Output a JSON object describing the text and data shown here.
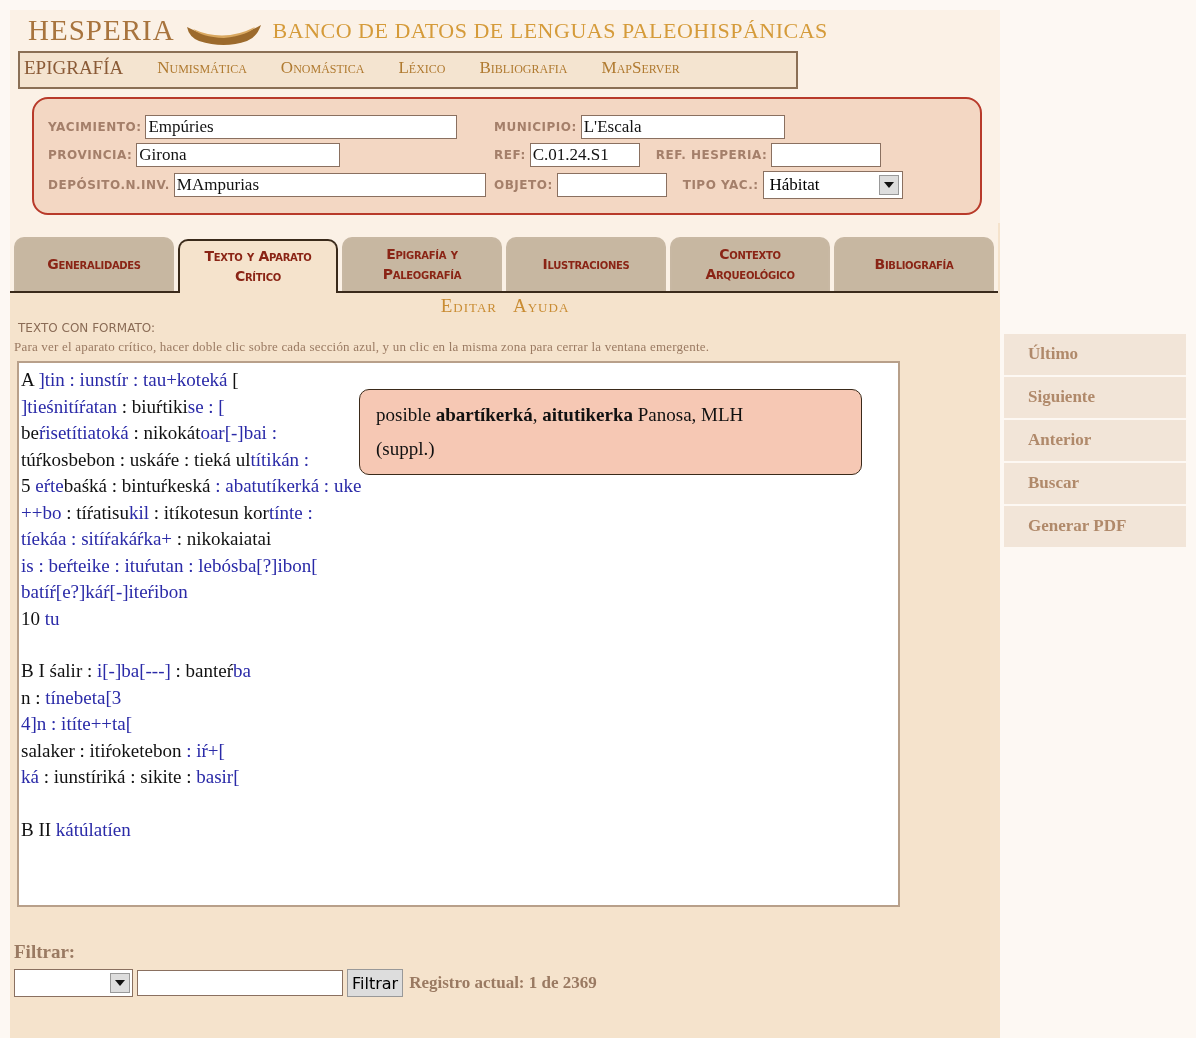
{
  "header": {
    "title": "HESPERIA",
    "subtitle": "BANCO DE DATOS DE LENGUAS PALEOHISPÁNICAS"
  },
  "nav": [
    {
      "label": "EPIGRAFÍA",
      "selected": true
    },
    {
      "label": "Numismática",
      "selected": false
    },
    {
      "label": "Onomástica",
      "selected": false
    },
    {
      "label": "Léxico",
      "selected": false
    },
    {
      "label": "Bibliografia",
      "selected": false
    },
    {
      "label": "MapServer",
      "selected": false
    }
  ],
  "form": {
    "rows": [
      [
        {
          "label": "YACIMIENTO:",
          "value": "Empúries",
          "kind": "text"
        },
        {
          "label": "MUNICIPIO:",
          "value": "L'Escala",
          "kind": "text"
        }
      ],
      [
        {
          "label": "PROVINCIA:",
          "value": "Girona",
          "kind": "text"
        },
        {
          "label": "REF:",
          "value": "C.01.24.S1",
          "kind": "text"
        },
        {
          "label": "REF. HESPERIA:",
          "kind": "text"
        }
      ],
      [
        {
          "label": "DEPÓSITO.N.INV.",
          "value": "MAmpurias",
          "kind": "text"
        },
        {
          "label": "OBJETO:",
          "kind": "text"
        },
        {
          "label": "TIPO YAC.:",
          "value": "Hábitat",
          "kind": "select"
        }
      ]
    ]
  },
  "tabs": [
    {
      "label": "Generalidades",
      "selected": false
    },
    {
      "label": "Texto y Aparato Crítico",
      "selected": true
    },
    {
      "label": "Epigrafía y Paleografía",
      "selected": false
    },
    {
      "label": "Ilustraciones",
      "selected": false
    },
    {
      "label": "Contexto Arqueológico",
      "selected": false
    },
    {
      "label": "Bibliografía",
      "selected": false
    }
  ],
  "actions": [
    "Editar",
    "Ayuda"
  ],
  "text_panel": {
    "heading": "TEXTO CON FORMATO:",
    "hint": "Para ver el aparato crítico, hacer doble clic sobre cada sección azul, y un clic en la misma zona para cerrar la ventana emergente.",
    "sections": [
      {
        "lines": [
          [
            {
              "t": "A ",
              "marked": false
            },
            {
              "t": "]tin : iunstír : tau+koteká",
              "marked": true
            },
            {
              "t": " [",
              "marked": false
            }
          ],
          [
            {
              "t": "]tieśnitíŕatan",
              "marked": true
            },
            {
              "t": " : biuŕtiki",
              "marked": false
            },
            {
              "t": "se : [",
              "marked": true
            }
          ],
          [
            {
              "t": "be",
              "marked": false
            },
            {
              "t": "ŕisetítiatoká",
              "marked": true
            },
            {
              "t": " : nikokát",
              "marked": false
            },
            {
              "t": "oar[-]bai :",
              "marked": true
            }
          ],
          [
            {
              "t": "túŕkosbebon : uskáŕe : tieká ul",
              "marked": false
            },
            {
              "t": "títikán :",
              "marked": true
            }
          ],
          [
            {
              "t": "5 ",
              "marked": false
            },
            {
              "t": "eŕte",
              "marked": true
            },
            {
              "t": "baśká : bintuŕkeská",
              "marked": false
            },
            {
              "t": " : abatutíkerká : uke",
              "marked": true
            }
          ],
          [
            {
              "t": "++bo",
              "marked": true
            },
            {
              "t": " : tíŕatisu",
              "marked": false
            },
            {
              "t": "kil",
              "marked": true
            },
            {
              "t": " : itíkotesun kor",
              "marked": false
            },
            {
              "t": "tínte :",
              "marked": true
            }
          ],
          [
            {
              "t": "tíekáa : sitíŕakáŕka+",
              "marked": true
            },
            {
              "t": " : nikokaiatai",
              "marked": false
            }
          ],
          [
            {
              "t": "is : beŕteike : ituŕutan : lebósba[?]ibon[",
              "marked": true
            }
          ],
          [
            {
              "t": "batíŕ[e?]káŕ[-]iteŕibon",
              "marked": true
            }
          ],
          [
            {
              "t": "10 ",
              "marked": false
            },
            {
              "t": "tu",
              "marked": true
            }
          ]
        ]
      },
      {
        "lines": [
          [
            {
              "t": "B I śalir : ",
              "marked": false
            },
            {
              "t": "i[-]ba[---]",
              "marked": true
            },
            {
              "t": " : banteŕ",
              "marked": false
            },
            {
              "t": "ba",
              "marked": true
            }
          ],
          [
            {
              "t": "n : ",
              "marked": false
            },
            {
              "t": "tínebeta[3",
              "marked": true
            }
          ],
          [
            {
              "t": "4]n : itíte++ta[",
              "marked": true
            }
          ],
          [
            {
              "t": "salaker : itiŕoketebon",
              "marked": false
            },
            {
              "t": " : iŕ+[",
              "marked": true
            }
          ],
          [
            {
              "t": "ká",
              "marked": true
            },
            {
              "t": " : iunstíriká : sikite : ",
              "marked": false
            },
            {
              "t": "basir[",
              "marked": true
            }
          ]
        ]
      },
      {
        "lines": [
          [
            {
              "t": "B II ",
              "marked": false
            },
            {
              "t": "kátúlatíen",
              "marked": true
            }
          ]
        ]
      }
    ],
    "popup": "posible **abartíkerká**, **aitutikerka** Panosa, MLH (suppl.)"
  },
  "sidebar": [
    "Último",
    "Siguiente",
    "Anterior",
    "Buscar",
    "Generar PDF"
  ],
  "filter": {
    "label": "Filtrar:",
    "button": "Filtrar",
    "status": "Registro actual: 1 de 2369"
  }
}
